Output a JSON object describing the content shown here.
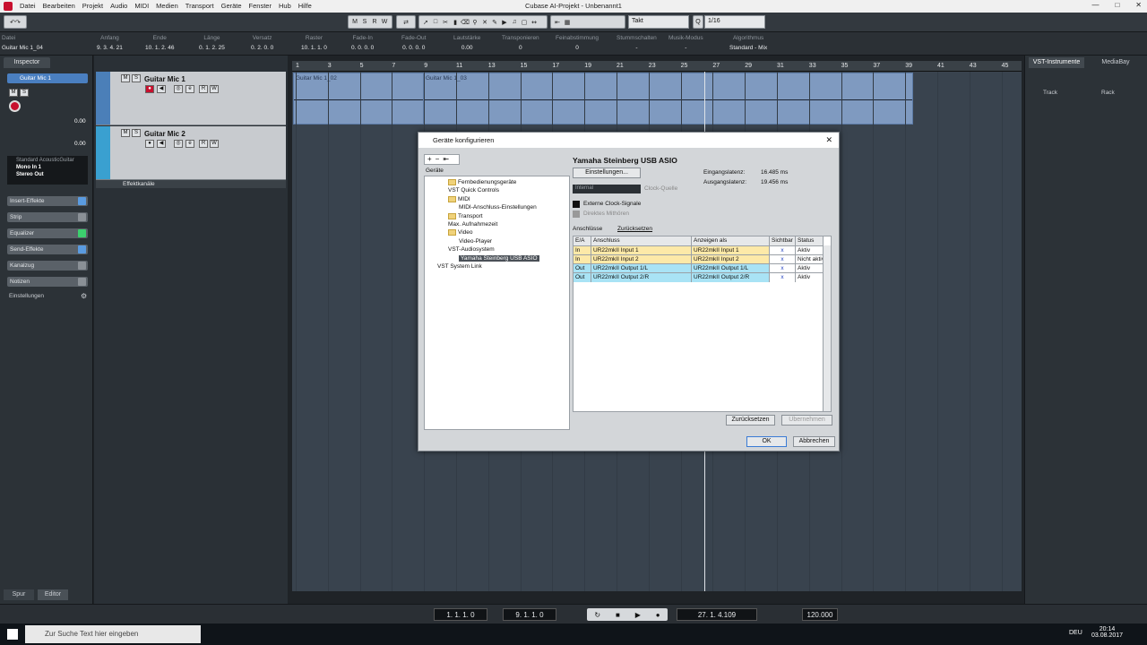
{
  "window": {
    "title": "Cubase AI-Projekt - Unbenannt1"
  },
  "menu": [
    "Datei",
    "Bearbeiten",
    "Projekt",
    "Audio",
    "MIDI",
    "Medien",
    "Transport",
    "Geräte",
    "Fenster",
    "Hub",
    "Hilfe"
  ],
  "toolbar": {
    "msrw": [
      "M",
      "S",
      "R",
      "W"
    ],
    "quantize_type": "Takt",
    "quantize_value": "1/16"
  },
  "infoline": [
    {
      "h": "Datei",
      "v": "Guitar Mic 1_04"
    },
    {
      "h": "Anfang",
      "v": "9. 3. 4. 21"
    },
    {
      "h": "Ende",
      "v": "10. 1. 2. 46"
    },
    {
      "h": "Länge",
      "v": "0. 1. 2. 25"
    },
    {
      "h": "Versatz",
      "v": "0. 2. 0. 0"
    },
    {
      "h": "Raster",
      "v": "10. 1. 1. 0"
    },
    {
      "h": "Fade-In",
      "v": "0. 0. 0. 0"
    },
    {
      "h": "Fade-Out",
      "v": "0. 0. 0. 0"
    },
    {
      "h": "Lautstärke",
      "v": "0.00"
    },
    {
      "h": "Transponieren",
      "v": "0"
    },
    {
      "h": "Feinabstimmung",
      "v": "0"
    },
    {
      "h": "Stummschalten",
      "v": "-"
    },
    {
      "h": "Musik-Modus",
      "v": "-"
    },
    {
      "h": "Algorithmus",
      "v": "Standard - Mix"
    }
  ],
  "inspector": {
    "tab": "Inspector",
    "track_name": "Guitar Mic 1",
    "value1": "0.00",
    "value2": "0.00",
    "preset": "Standard AcousticGuitar",
    "input": "Mono In 1",
    "output": "Stereo Out",
    "sections": [
      "Insert-Effekte",
      "Strip",
      "Equalizer",
      "Send-Effekte",
      "Kanalzug",
      "Notizen"
    ],
    "settings": "Einstellungen",
    "bottom_tabs": [
      "Spur",
      "Editor"
    ]
  },
  "tracks": [
    {
      "name": "Guitar Mic 1",
      "color": "#4b7fb8"
    },
    {
      "name": "Guitar Mic 2",
      "color": "#3aa0d0"
    }
  ],
  "fx_folder": "Effektkanäle",
  "ruler": [
    "1",
    "3",
    "5",
    "7",
    "9",
    "11",
    "13",
    "15",
    "17",
    "19",
    "21",
    "23",
    "25",
    "27",
    "29",
    "31",
    "33",
    "35",
    "37",
    "39",
    "41",
    "43",
    "45"
  ],
  "events": [
    {
      "label": "Guitar Mic 1_02"
    },
    {
      "label": "Guitar Mic 1_03"
    }
  ],
  "rightzone": {
    "tabs": [
      "VST-Instrumente",
      "MediaBay"
    ],
    "track_label": "Track",
    "rack_label": "Rack"
  },
  "transport": {
    "left_locator": "1. 1. 1. 0",
    "right_locator": "9. 1. 1. 0",
    "position": "27. 1. 4.109",
    "tempo": "120.000"
  },
  "taskbar": {
    "search": "Zur Suche Text hier eingeben",
    "lang": "DEU",
    "time": "20:14",
    "date": "03.08.2017"
  },
  "dialog": {
    "title": "Geräte konfigurieren",
    "tree_header": "Geräte",
    "tree": [
      {
        "label": "Fernbedienungsgeräte",
        "level": 1,
        "folder": true
      },
      {
        "label": "VST Quick Controls",
        "level": 1,
        "folder": false
      },
      {
        "label": "MIDI",
        "level": 1,
        "folder": true
      },
      {
        "label": "MIDI-Anschluss-Einstellungen",
        "level": 2,
        "folder": false
      },
      {
        "label": "Transport",
        "level": 1,
        "folder": true
      },
      {
        "label": "Max. Aufnahmezeit",
        "level": 1,
        "folder": false
      },
      {
        "label": "Video",
        "level": 1,
        "folder": true
      },
      {
        "label": "Video-Player",
        "level": 2,
        "folder": false
      },
      {
        "label": "VST-Audiosystem",
        "level": 1,
        "folder": false
      },
      {
        "label": "Yamaha Steinberg USB ASIO",
        "level": 2,
        "folder": false,
        "selected": true
      },
      {
        "label": "VST System Link",
        "level": 0,
        "folder": false
      }
    ],
    "heading": "Yamaha Steinberg USB ASIO",
    "settings_btn": "Einstellungen...",
    "in_latency_label": "Eingangslatenz:",
    "in_latency": "16.485 ms",
    "out_latency_label": "Ausgangslatenz:",
    "out_latency": "19.456 ms",
    "clock_value": "Internal",
    "clock_label": "Clock-Quelle",
    "ext_clock": "Externe Clock-Signale",
    "direct_monitor": "Direktes Mithören",
    "ports_tab": "Anschlüsse",
    "reset_tab": "Zurücksetzen",
    "columns": [
      "E/A",
      "Anschluss",
      "Anzeigen als",
      "Sichtbar",
      "Status"
    ],
    "rows": [
      {
        "io": "In",
        "port": "UR22mkII Input 1",
        "show": "UR22mkII Input 1",
        "vis": "x",
        "status": "Aktiv",
        "type": "in"
      },
      {
        "io": "In",
        "port": "UR22mkII Input 2",
        "show": "UR22mkII Input 2",
        "vis": "x",
        "status": "Nicht aktiv",
        "type": "in"
      },
      {
        "io": "Out",
        "port": "UR22mkII Output 1/L",
        "show": "UR22mkII Output 1/L",
        "vis": "x",
        "status": "Aktiv",
        "type": "out"
      },
      {
        "io": "Out",
        "port": "UR22mkII Output 2/R",
        "show": "UR22mkII Output 2/R",
        "vis": "x",
        "status": "Aktiv",
        "type": "out"
      }
    ],
    "reset_btn": "Zurücksetzen",
    "apply_btn": "Übernehmen",
    "ok_btn": "OK",
    "cancel_btn": "Abbrechen"
  },
  "colors": {
    "in_row": "#fde9a8",
    "out_row": "#a9e3f5",
    "accent": "#c8102e"
  }
}
